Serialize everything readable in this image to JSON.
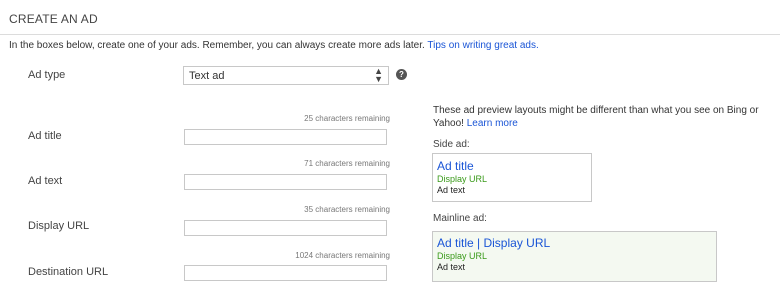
{
  "header": {
    "title": "CREATE AN AD",
    "intro_text": "In the boxes below, create one of your ads. Remember, you can always create more ads later. ",
    "tips_link": "Tips on writing great ads."
  },
  "form": {
    "ad_type": {
      "label": "Ad type",
      "value": "Text ad",
      "chevron_icon": "select-arrows-icon",
      "help_icon": "question-icon"
    },
    "ad_title": {
      "label": "Ad title",
      "remaining": "25 characters remaining",
      "value": ""
    },
    "ad_text": {
      "label": "Ad text",
      "remaining": "71 characters remaining",
      "value": ""
    },
    "display_url": {
      "label": "Display URL",
      "remaining": "35 characters remaining",
      "value": ""
    },
    "destination_url": {
      "label": "Destination URL",
      "remaining": "1024 characters remaining",
      "value": ""
    }
  },
  "preview": {
    "note": "These ad preview layouts might be different than what you see on Bing or Yahoo! ",
    "learn_more": "Learn more",
    "side_label": "Side ad:",
    "side_ad": {
      "title": "Ad title",
      "url": "Display URL",
      "text": "Ad text"
    },
    "mainline_label": "Mainline ad:",
    "mainline_ad": {
      "title": "Ad title | Display URL",
      "url": "Display URL",
      "text": "Ad text"
    }
  },
  "colors": {
    "link": "#1a55d6",
    "display_url": "#3a9a1a",
    "mainline_bg": "#f4f9f1"
  }
}
